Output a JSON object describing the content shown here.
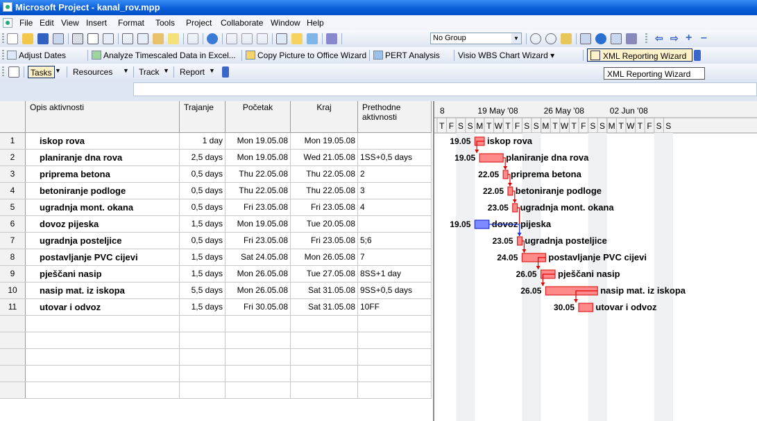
{
  "window": {
    "title": "Microsoft Project - kanal_rov.mpp"
  },
  "menu": [
    "File",
    "Edit",
    "View",
    "Insert",
    "Format",
    "Tools",
    "Project",
    "Collaborate",
    "Window",
    "Help"
  ],
  "standard_toolbar": {
    "group_combo": "No Group"
  },
  "wizard_toolbar": {
    "items": [
      "Adjust Dates",
      "Analyze Timescaled Data in Excel...",
      "Copy Picture to Office Wizard",
      "PERT Analysis",
      "Visio WBS Chart Wizard ▾",
      "XML Reporting Wizard"
    ]
  },
  "view_toolbar": {
    "tasks": "Tasks",
    "resources": "Resources",
    "track": "Track",
    "report": "Report",
    "tooltip": "XML Reporting Wizard"
  },
  "table": {
    "columns": [
      "Opis aktivnosti",
      "Trajanje",
      "Početak",
      "Kraj",
      "Prethodne aktivnosti"
    ],
    "rows": [
      {
        "id": "1",
        "name": "iskop rova",
        "duration": "1 day",
        "start": "Mon 19.05.08",
        "finish": "Mon 19.05.08",
        "pred": ""
      },
      {
        "id": "2",
        "name": "planiranje dna rova",
        "duration": "2,5 days",
        "start": "Mon 19.05.08",
        "finish": "Wed 21.05.08",
        "pred": "1SS+0,5 days"
      },
      {
        "id": "3",
        "name": "priprema betona",
        "duration": "0,5 days",
        "start": "Thu 22.05.08",
        "finish": "Thu 22.05.08",
        "pred": "2"
      },
      {
        "id": "4",
        "name": "betoniranje podloge",
        "duration": "0,5 days",
        "start": "Thu 22.05.08",
        "finish": "Thu 22.05.08",
        "pred": "3"
      },
      {
        "id": "5",
        "name": "ugradnja mont. okana",
        "duration": "0,5 days",
        "start": "Fri 23.05.08",
        "finish": "Fri 23.05.08",
        "pred": "4"
      },
      {
        "id": "6",
        "name": "dovoz pijeska",
        "duration": "1,5 days",
        "start": "Mon 19.05.08",
        "finish": "Tue 20.05.08",
        "pred": ""
      },
      {
        "id": "7",
        "name": "ugradnja posteljice",
        "duration": "0,5 days",
        "start": "Fri 23.05.08",
        "finish": "Fri 23.05.08",
        "pred": "5;6"
      },
      {
        "id": "8",
        "name": "postavljanje PVC cijevi",
        "duration": "1,5 days",
        "start": "Sat 24.05.08",
        "finish": "Mon 26.05.08",
        "pred": "7"
      },
      {
        "id": "9",
        "name": "pješčani nasip",
        "duration": "1,5 days",
        "start": "Mon 26.05.08",
        "finish": "Tue 27.05.08",
        "pred": "8SS+1 day"
      },
      {
        "id": "10",
        "name": "nasip mat. iz iskopa",
        "duration": "5,5 days",
        "start": "Mon 26.05.08",
        "finish": "Sat 31.05.08",
        "pred": "9SS+0,5 days"
      },
      {
        "id": "11",
        "name": "utovar i odvoz",
        "duration": "1,5 days",
        "start": "Fri 30.05.08",
        "finish": "Sat 31.05.08",
        "pred": "10FF"
      }
    ]
  },
  "gantt": {
    "weeks": [
      "8",
      "19 May '08",
      "26 May '08",
      "02 Jun '08"
    ],
    "days": [
      "T",
      "F",
      "S",
      "S",
      "M",
      "T",
      "W",
      "T",
      "F",
      "S",
      "S",
      "M",
      "T",
      "W",
      "T",
      "F",
      "S",
      "S",
      "M",
      "T",
      "W",
      "T",
      "F",
      "S",
      "S"
    ],
    "start_labels": [
      "19.05",
      "19.05",
      "22.05",
      "22.05",
      "23.05",
      "19.05",
      "23.05",
      "24.05",
      "26.05",
      "26.05",
      "30.05"
    ],
    "task_color": "#e02020",
    "task_fill": "#ff8a8a",
    "selected_task_color": "#2233cc",
    "link_color": "#e00000"
  },
  "chart_data": {
    "type": "gantt",
    "tasks": [
      {
        "id": 1,
        "name": "iskop rova",
        "start": "2008-05-19",
        "start_offset_days": 0.0,
        "duration_days": 1.0
      },
      {
        "id": 2,
        "name": "planiranje dna rova",
        "start": "2008-05-19",
        "start_offset_days": 0.5,
        "duration_days": 2.5
      },
      {
        "id": 3,
        "name": "priprema betona",
        "start": "2008-05-22",
        "start_offset_days": 3.0,
        "duration_days": 0.5
      },
      {
        "id": 4,
        "name": "betoniranje podloge",
        "start": "2008-05-22",
        "start_offset_days": 3.5,
        "duration_days": 0.5
      },
      {
        "id": 5,
        "name": "ugradnja mont. okana",
        "start": "2008-05-23",
        "start_offset_days": 4.0,
        "duration_days": 0.5
      },
      {
        "id": 6,
        "name": "dovoz pijeska",
        "start": "2008-05-19",
        "start_offset_days": 0.0,
        "duration_days": 1.5
      },
      {
        "id": 7,
        "name": "ugradnja posteljice",
        "start": "2008-05-23",
        "start_offset_days": 4.5,
        "duration_days": 0.5
      },
      {
        "id": 8,
        "name": "postavljanje PVC cijevi",
        "start": "2008-05-24",
        "start_offset_days": 5.0,
        "duration_days": 2.5
      },
      {
        "id": 9,
        "name": "pješčani nasip",
        "start": "2008-05-26",
        "start_offset_days": 7.0,
        "duration_days": 1.5
      },
      {
        "id": 10,
        "name": "nasip mat. iz iskopa",
        "start": "2008-05-26",
        "start_offset_days": 7.5,
        "duration_days": 5.5
      },
      {
        "id": 11,
        "name": "utovar i odvoz",
        "start": "2008-05-30",
        "start_offset_days": 11.0,
        "duration_days": 1.5
      }
    ],
    "links": [
      [
        1,
        2
      ],
      [
        2,
        3
      ],
      [
        3,
        4
      ],
      [
        4,
        5
      ],
      [
        5,
        7
      ],
      [
        6,
        7
      ],
      [
        7,
        8
      ],
      [
        8,
        9
      ],
      [
        9,
        10
      ],
      [
        10,
        11
      ]
    ]
  }
}
